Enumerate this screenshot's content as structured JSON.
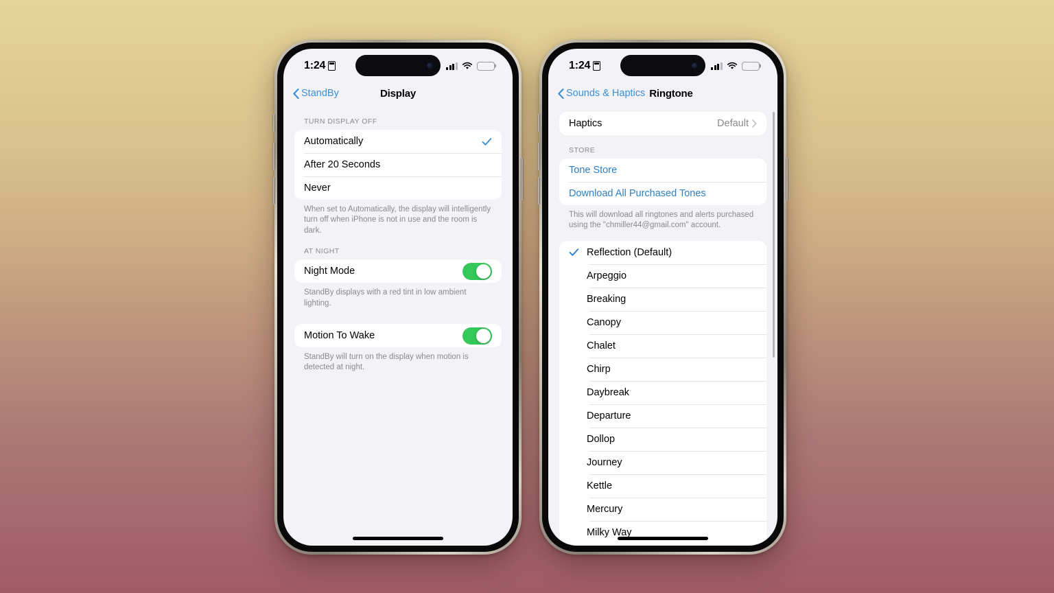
{
  "background": {
    "top_color": "#e5d49a",
    "bottom_color": "#a05c66"
  },
  "accent_colors": {
    "link": "#2f7fc4",
    "tint": "#3c8fd4",
    "toggle_on": "#34c759",
    "check": "#2f7fc4"
  },
  "phones": [
    {
      "id": "left",
      "status_bar": {
        "time": "1:24",
        "battery_level_percent": 22,
        "cellular_bars": 3,
        "wifi": "full"
      },
      "nav": {
        "back_label": "StandBy",
        "title": "Display",
        "title_placement": "centered"
      },
      "sections": [
        {
          "header": "TURN DISPLAY OFF",
          "rows": [
            {
              "label": "Automatically",
              "type": "check-right",
              "checked": true
            },
            {
              "label": "After 20 Seconds",
              "type": "plain",
              "checked": false
            },
            {
              "label": "Never",
              "type": "plain",
              "checked": false
            }
          ],
          "footnote": "When set to Automatically, the display will intelligently turn off when iPhone is not in use and the room is dark."
        },
        {
          "header": "AT NIGHT",
          "rows": [
            {
              "label": "Night Mode",
              "type": "toggle",
              "toggle_on": true
            }
          ],
          "footnote": "StandBy displays with a red tint in low ambient lighting."
        },
        {
          "header": "",
          "rows": [
            {
              "label": "Motion To Wake",
              "type": "toggle",
              "toggle_on": true
            }
          ],
          "footnote": "StandBy will turn on the display when motion is detected at night."
        }
      ]
    },
    {
      "id": "right",
      "status_bar": {
        "time": "1:24",
        "battery_level_percent": 22,
        "cellular_bars": 3,
        "wifi": "full"
      },
      "nav": {
        "back_label": "Sounds & Haptics",
        "title": "Ringtone",
        "title_placement": "inline"
      },
      "haptics": {
        "label": "Haptics",
        "value": "Default"
      },
      "store": {
        "header": "STORE",
        "items": [
          {
            "label": "Tone Store"
          },
          {
            "label": "Download All Purchased Tones"
          }
        ],
        "footnote": "This will download all ringtones and alerts purchased using the \"chmiller44@gmail.com\" account."
      },
      "ringtones": [
        {
          "label": "Reflection (Default)",
          "selected": true
        },
        {
          "label": "Arpeggio",
          "selected": false
        },
        {
          "label": "Breaking",
          "selected": false
        },
        {
          "label": "Canopy",
          "selected": false
        },
        {
          "label": "Chalet",
          "selected": false
        },
        {
          "label": "Chirp",
          "selected": false
        },
        {
          "label": "Daybreak",
          "selected": false
        },
        {
          "label": "Departure",
          "selected": false
        },
        {
          "label": "Dollop",
          "selected": false
        },
        {
          "label": "Journey",
          "selected": false
        },
        {
          "label": "Kettle",
          "selected": false
        },
        {
          "label": "Mercury",
          "selected": false
        },
        {
          "label": "Milky Way",
          "selected": false
        }
      ]
    }
  ]
}
